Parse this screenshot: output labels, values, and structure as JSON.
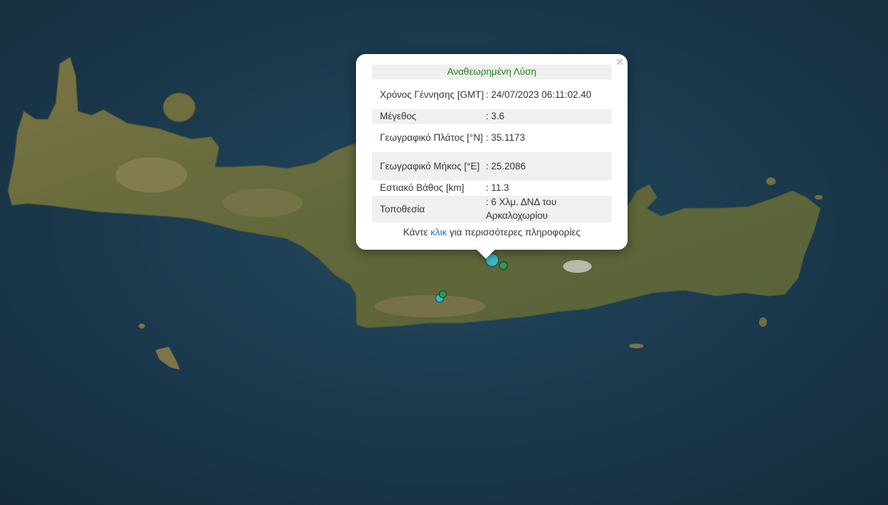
{
  "map": {
    "colors": {
      "sea": "#1b3a4f",
      "land": "#6b6c3c",
      "epicenter_main": "#3fb9c9",
      "epicenter_secondary": "#2e9b55"
    }
  },
  "popup": {
    "close_label": "×",
    "header": "Αναθεωρημένη Λύση",
    "rows": [
      {
        "key": "Χρόνος Γέννησης [GMT]",
        "value": ": 24/07/2023 06:11:02.40"
      },
      {
        "key": "Μέγεθος",
        "value": ": 3.6"
      },
      {
        "key": "Γεωγραφικό Πλάτος [°N]",
        "value": ": 35.1173"
      },
      {
        "key": "Γεωγραφικό Μήκος [°E]",
        "value": ": 25.2086"
      },
      {
        "key": "Εστιακό Βάθος [km]",
        "value": ": 11.3"
      },
      {
        "key": "Τοποθεσία",
        "value": ": 6 Χλμ. ΔΝΔ του Αρκαλοχωρίου"
      }
    ],
    "footer": {
      "before": "Κάντε ",
      "link": "κλικ",
      "after": " για περισσότερες πληροφορίες"
    }
  }
}
